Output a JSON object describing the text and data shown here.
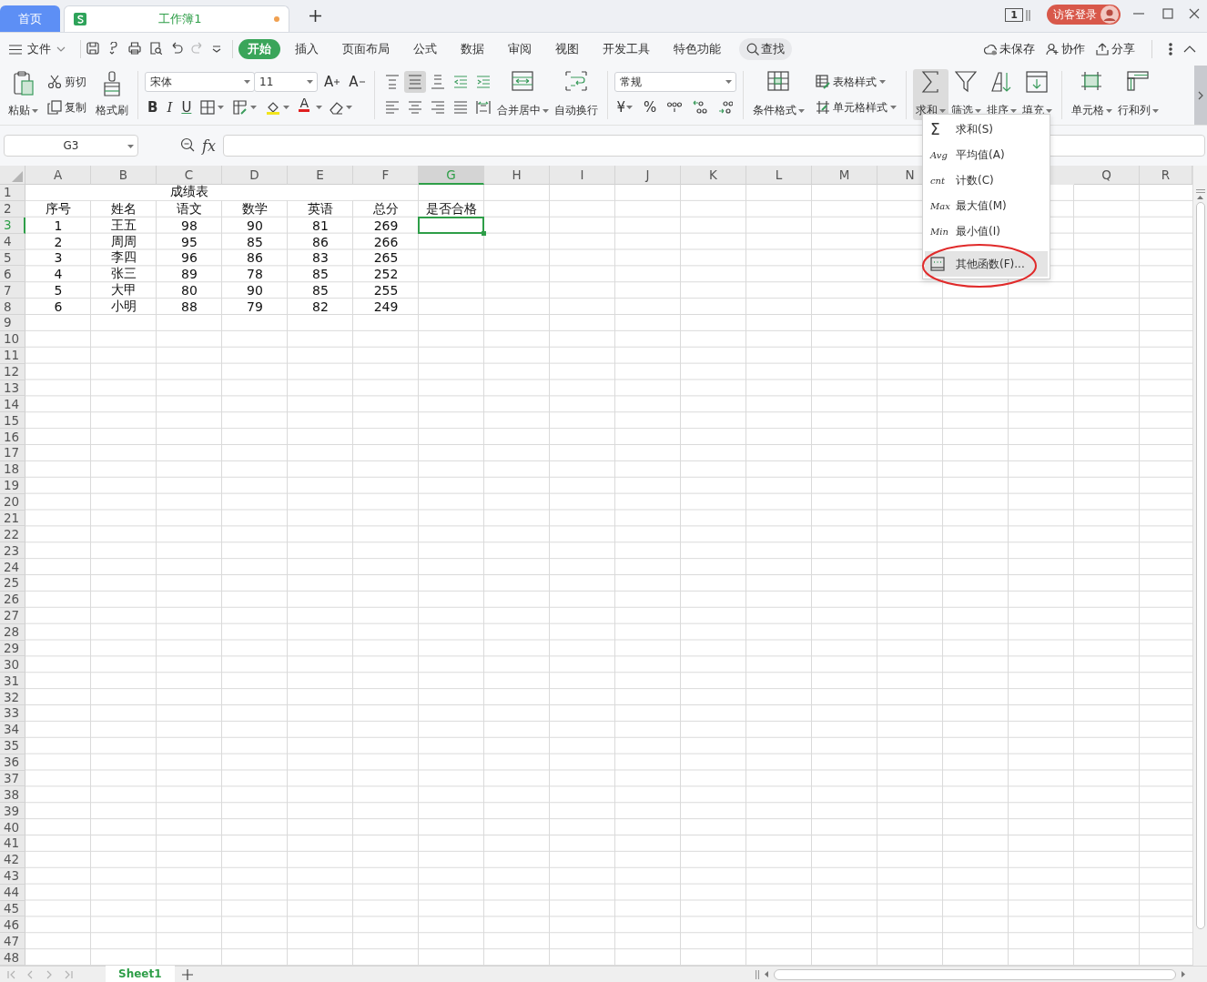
{
  "tabs": [
    {
      "label": "首页",
      "selected": false,
      "kind": "home"
    },
    {
      "label": "工作簿1",
      "selected": true,
      "kind": "workbook",
      "modified": true
    }
  ],
  "title_bar": {
    "window_count": "1",
    "login": "访客登录"
  },
  "menu_bar": {
    "file": "文件",
    "quick_access": [
      {
        "disabled": false
      },
      {
        "disabled": false
      },
      {
        "disabled": false
      },
      {
        "disabled": false
      },
      {
        "disabled": false
      },
      {
        "disabled": true
      }
    ],
    "tabs": [
      {
        "label": "开始",
        "selected": true
      },
      {
        "label": "插入",
        "selected": false
      },
      {
        "label": "页面布局",
        "selected": false
      },
      {
        "label": "公式",
        "selected": false
      },
      {
        "label": "数据",
        "selected": false
      },
      {
        "label": "审阅",
        "selected": false
      },
      {
        "label": "视图",
        "selected": false
      },
      {
        "label": "开发工具",
        "selected": false
      },
      {
        "label": "特色功能",
        "selected": false
      }
    ],
    "search": "查找",
    "actions": [
      "未保存",
      "协作",
      "分享"
    ]
  },
  "ribbon": {
    "paste": "粘贴",
    "cut": "剪切",
    "copy": "复制",
    "format_painter": "格式刷",
    "font_name": "宋体",
    "font_size": "11",
    "font_grow": "A",
    "font_shrink": "A",
    "bold": "B",
    "italic": "I",
    "underline": "U",
    "font_color": "A",
    "alignment": [
      {
        "selected": false
      },
      {
        "selected": true
      },
      {
        "selected": false
      },
      {
        "selected": false
      },
      {
        "selected": false
      },
      {
        "selected": false
      },
      {
        "selected": false
      },
      {
        "selected": false
      },
      {
        "selected": false
      },
      {
        "selected": false
      }
    ],
    "merge_center": "合并居中",
    "wrap_text": "自动换行",
    "number_format": "常规",
    "currency": "¥",
    "percent": "%",
    "conditional_format": "条件格式",
    "table_style": "表格样式",
    "cell_style": "单元格样式",
    "sum": {
      "label": "求和",
      "pressed": true
    },
    "filter": "筛选",
    "sort": "排序",
    "fill": "填充",
    "cells": "单元格",
    "rows_columns": "行和列"
  },
  "formula_bar": {
    "name_box": "G3",
    "fx": "fx"
  },
  "sheet": {
    "columns": [
      {
        "label": "A",
        "selected": false
      },
      {
        "label": "B",
        "selected": false
      },
      {
        "label": "C",
        "selected": false
      },
      {
        "label": "D",
        "selected": false
      },
      {
        "label": "E",
        "selected": false
      },
      {
        "label": "F",
        "selected": false
      },
      {
        "label": "G",
        "selected": true
      },
      {
        "label": "H",
        "selected": false
      },
      {
        "label": "I",
        "selected": false
      },
      {
        "label": "J",
        "selected": false
      },
      {
        "label": "K",
        "selected": false
      },
      {
        "label": "L",
        "selected": false
      },
      {
        "label": "M",
        "selected": false
      },
      {
        "label": "N",
        "selected": false
      },
      {
        "label": "Q",
        "selected": false
      },
      {
        "label": "R",
        "selected": false
      }
    ],
    "rows": [
      {
        "label": "1",
        "selected": false
      },
      {
        "label": "2",
        "selected": false
      },
      {
        "label": "3",
        "selected": true
      },
      {
        "label": "4",
        "selected": false
      },
      {
        "label": "5",
        "selected": false
      },
      {
        "label": "6",
        "selected": false
      },
      {
        "label": "7",
        "selected": false
      },
      {
        "label": "8",
        "selected": false
      },
      {
        "label": "9",
        "selected": false
      },
      {
        "label": "10",
        "selected": false
      },
      {
        "label": "11",
        "selected": false
      },
      {
        "label": "12",
        "selected": false
      },
      {
        "label": "13",
        "selected": false
      },
      {
        "label": "14",
        "selected": false
      },
      {
        "label": "15",
        "selected": false
      },
      {
        "label": "16",
        "selected": false
      },
      {
        "label": "17",
        "selected": false
      },
      {
        "label": "18",
        "selected": false
      },
      {
        "label": "19",
        "selected": false
      },
      {
        "label": "20",
        "selected": false
      },
      {
        "label": "21",
        "selected": false
      },
      {
        "label": "22",
        "selected": false
      },
      {
        "label": "23",
        "selected": false
      },
      {
        "label": "24",
        "selected": false
      },
      {
        "label": "25",
        "selected": false
      },
      {
        "label": "26",
        "selected": false
      },
      {
        "label": "27",
        "selected": false
      },
      {
        "label": "28",
        "selected": false
      },
      {
        "label": "29",
        "selected": false
      },
      {
        "label": "30",
        "selected": false
      },
      {
        "label": "31",
        "selected": false
      },
      {
        "label": "32",
        "selected": false
      },
      {
        "label": "33",
        "selected": false
      },
      {
        "label": "34",
        "selected": false
      },
      {
        "label": "35",
        "selected": false
      },
      {
        "label": "36",
        "selected": false
      },
      {
        "label": "37",
        "selected": false
      },
      {
        "label": "38",
        "selected": false
      },
      {
        "label": "39",
        "selected": false
      },
      {
        "label": "40",
        "selected": false
      },
      {
        "label": "41",
        "selected": false
      },
      {
        "label": "42",
        "selected": false
      },
      {
        "label": "43",
        "selected": false
      },
      {
        "label": "44",
        "selected": false
      },
      {
        "label": "45",
        "selected": false
      },
      {
        "label": "46",
        "selected": false
      },
      {
        "label": "47",
        "selected": false
      },
      {
        "label": "48",
        "selected": false
      }
    ],
    "title": "成绩表",
    "header": [
      "序号",
      "姓名",
      "语文",
      "数学",
      "英语",
      "总分",
      "是否合格"
    ],
    "data": [
      [
        "1",
        "王五",
        "98",
        "90",
        "81",
        "269"
      ],
      [
        "2",
        "周周",
        "95",
        "85",
        "86",
        "266"
      ],
      [
        "3",
        "李四",
        "96",
        "86",
        "83",
        "265"
      ],
      [
        "4",
        "张三",
        "89",
        "78",
        "85",
        "252"
      ],
      [
        "5",
        "大甲",
        "80",
        "90",
        "85",
        "255"
      ],
      [
        "6",
        "小明",
        "88",
        "79",
        "82",
        "249"
      ]
    ]
  },
  "sheet_tabs": {
    "nav_disabled": true,
    "sheets": [
      {
        "label": "Sheet1",
        "selected": true
      }
    ]
  },
  "dropdown": {
    "items": [
      {
        "symbol": "Σ",
        "label": "求和(S)",
        "highlighted": false,
        "separator_before": false,
        "circled": false
      },
      {
        "symbol": "Avg",
        "label": "平均值(A)",
        "highlighted": false,
        "separator_before": false,
        "circled": false
      },
      {
        "symbol": "cnt",
        "label": "计数(C)",
        "highlighted": false,
        "separator_before": false,
        "circled": false
      },
      {
        "symbol": "Max",
        "label": "最大值(M)",
        "highlighted": false,
        "separator_before": false,
        "circled": false
      },
      {
        "symbol": "Min",
        "label": "最小值(I)",
        "highlighted": false,
        "separator_before": false,
        "circled": false
      },
      {
        "kind": "book",
        "label": "其他函数(F)...",
        "highlighted": true,
        "separator_before": true,
        "circled": true
      }
    ]
  }
}
